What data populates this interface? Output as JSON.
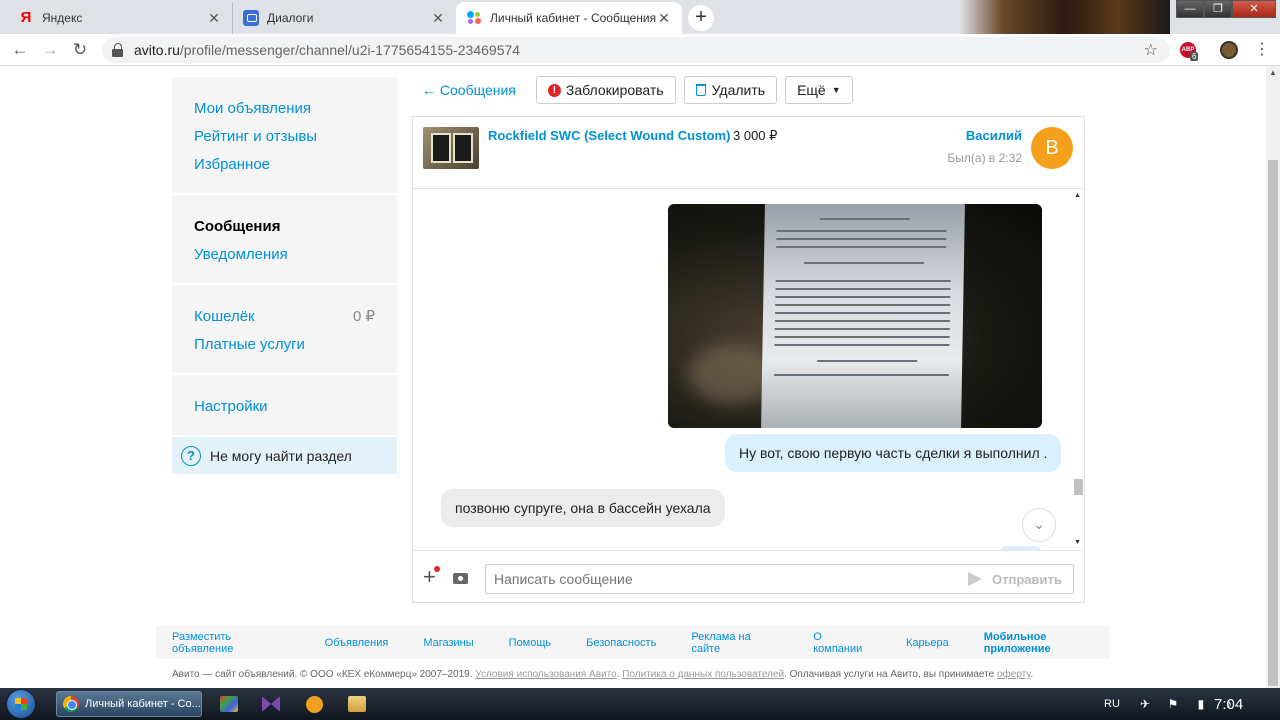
{
  "browser": {
    "tabs": [
      {
        "title": "Яндекс",
        "favicon": "yandex-icon"
      },
      {
        "title": "Диалоги",
        "favicon": "dialogs-icon"
      },
      {
        "title": "Личный кабинет - Сообщения - Ави",
        "favicon": "avito-icon",
        "active": true
      }
    ],
    "url_host": "avito.ru",
    "url_path": "/profile/messenger/channel/u2i-1775654155-23469574",
    "abp_label": "ABP",
    "abp_badge": "6"
  },
  "sidebar": {
    "group1": [
      "Мои объявления",
      "Рейтинг и отзывы",
      "Избранное"
    ],
    "group2": {
      "active": "Сообщения",
      "notifications": "Уведомления"
    },
    "group3": {
      "wallet": "Кошелёк",
      "wallet_amount": "0 ₽",
      "paid": "Платные услуги"
    },
    "group4": {
      "settings": "Настройки"
    },
    "help": "Не могу найти раздел"
  },
  "toolbar": {
    "back": "← Сообщения",
    "block": "Заблокировать",
    "delete": "Удалить",
    "more": "Ещё"
  },
  "chat": {
    "item_title": "Rockfield SWC (Select Wound Custom)",
    "item_price": "3 000 ₽",
    "user_name": "Василий",
    "user_seen": "Был(а) в 2:32",
    "avatar_letter": "В",
    "avatar_color": "#f5a01c",
    "messages": [
      {
        "direction": "out",
        "text": "Ну вот, свою первую часть сделки я выполнил ."
      },
      {
        "direction": "in",
        "text": "позвоню супруге, она в бассейн уехала"
      }
    ],
    "input_placeholder": "Написать сообщение",
    "send_label": "Отправить"
  },
  "footer": {
    "links": [
      "Разместить объявление",
      "Объявления",
      "Магазины",
      "Помощь",
      "Безопасность",
      "Реклама на сайте",
      "О компании",
      "Карьера"
    ],
    "app_link": "Мобильное приложение",
    "legal_prefix": "Авито — сайт объявлений. © ООО «КЕХ еКоммерц» 2007–2019.",
    "legal_terms": "Условия использования Авито",
    "legal_policy": "Политика о данных пользователей",
    "legal_suffix": "Оплачивая услуги на Авито, вы принимаете",
    "legal_offer": "оферту"
  },
  "taskbar": {
    "active_window": "Личный кабинет - Со...",
    "lang": "RU",
    "clock": "7:04"
  },
  "colors": {
    "link": "#0091d9",
    "outgoing_bubble": "#daf0fc",
    "incoming_bubble": "#ececec"
  }
}
